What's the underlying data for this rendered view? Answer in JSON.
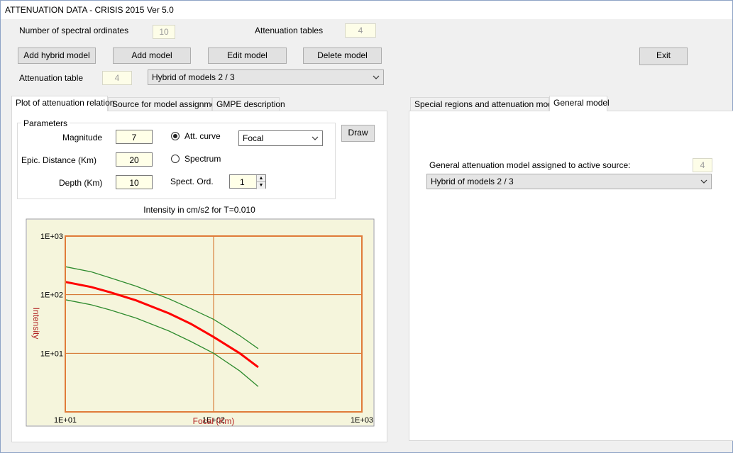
{
  "window": {
    "title": "ATTENUATION DATA - CRISIS 2015 Ver 5.0"
  },
  "top": {
    "num_spectral_label": "Number of spectral ordinates",
    "num_spectral_value": "10",
    "att_tables_label": "Attenuation tables",
    "att_tables_value": "4",
    "att_table_label": "Attenuation table",
    "att_table_value": "4",
    "att_table_select": "Hybrid of models 2 / 3"
  },
  "buttons": {
    "add_hybrid": "Add hybrid model",
    "add_model": "Add model",
    "edit_model": "Edit model",
    "delete_model": "Delete model",
    "exit": "Exit",
    "draw": "Draw"
  },
  "left_tabs": [
    "Plot of attenuation relation",
    "Source for model assignment",
    "GMPE description"
  ],
  "right_tabs": [
    "Special regions and attenuation models",
    "General model"
  ],
  "params": {
    "group_title": "Parameters",
    "magnitude_label": "Magnitude",
    "magnitude_value": "7",
    "distance_label": "Epic. Distance (Km)",
    "distance_value": "20",
    "depth_label": "Depth (Km)",
    "depth_value": "10",
    "att_curve_label": "Att. curve",
    "spectrum_label": "Spectrum",
    "spect_ord_label": "Spect. Ord.",
    "spect_ord_value": "1",
    "distance_type_select": "Focal"
  },
  "general": {
    "assigned_label": "General attenuation model assigned to active source:",
    "assigned_value": "4",
    "model_select": "Hybrid of models 2 / 3"
  },
  "colors": {
    "plot_bg": "#f5f5dc",
    "axes_frame": "#e07b39",
    "grid": "#d2691e",
    "median": "#ff0000",
    "bounds": "#2e8b2e",
    "axis_text": "#b22222"
  },
  "chart_data": {
    "type": "line",
    "title": "Intensity in cm/s2 for T=0.010",
    "xlabel": "Focal (Km)",
    "ylabel": "Intensity",
    "x_scale": "log",
    "y_scale": "log",
    "xlim": [
      10,
      1000
    ],
    "ylim": [
      1,
      1000
    ],
    "x_ticks": [
      "1E+01",
      "1E+02",
      "1E+03"
    ],
    "y_ticks": [
      "1E+03",
      "1E+02",
      "1E+01"
    ],
    "grid": true,
    "series": [
      {
        "role": "upper",
        "color": "#2e8b2e",
        "x": [
          10,
          15,
          20,
          30,
          50,
          70,
          100,
          150,
          200
        ],
        "y": [
          300,
          245,
          195,
          140,
          85,
          58,
          38,
          20,
          12
        ]
      },
      {
        "role": "median",
        "color": "#ff0000",
        "x": [
          10,
          15,
          20,
          30,
          50,
          70,
          100,
          150,
          200
        ],
        "y": [
          165,
          135,
          110,
          80,
          48,
          32,
          19,
          10,
          5.8
        ]
      },
      {
        "role": "lower",
        "color": "#2e8b2e",
        "x": [
          10,
          15,
          20,
          30,
          50,
          70,
          100,
          150,
          200
        ],
        "y": [
          82,
          67,
          55,
          40,
          24,
          16,
          10,
          5,
          2.7
        ]
      }
    ]
  }
}
